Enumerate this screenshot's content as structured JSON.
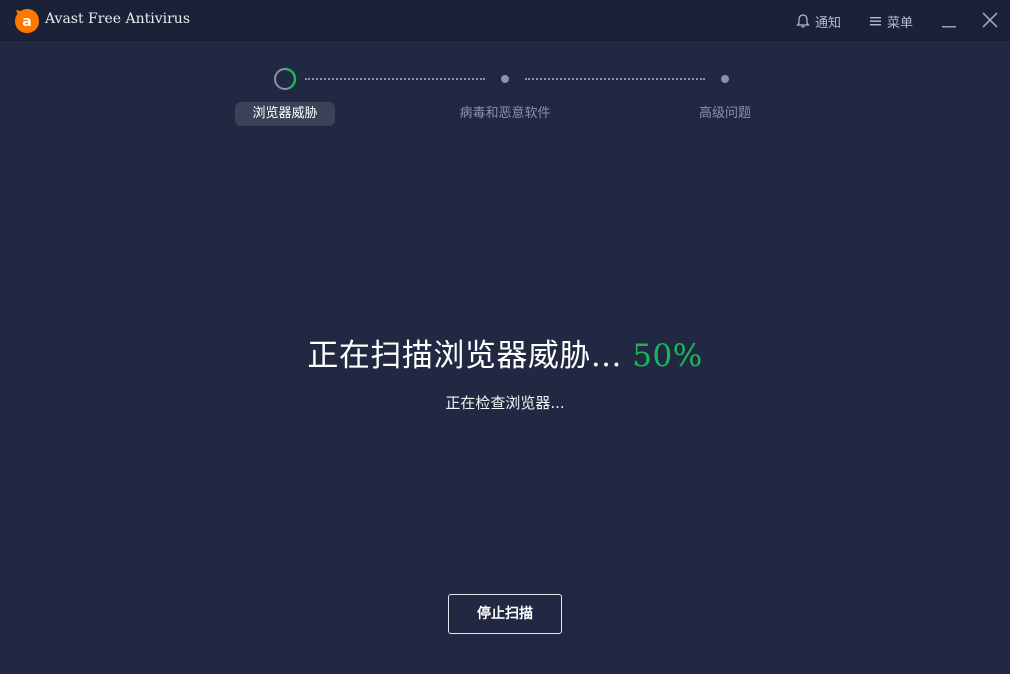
{
  "app": {
    "title": "Avast Free Antivirus",
    "brand_color": "#ff7800"
  },
  "titlebar": {
    "notify_label": "通知",
    "menu_label": "菜单"
  },
  "steps": [
    {
      "label": "浏览器威胁",
      "state": "active"
    },
    {
      "label": "病毒和恶意软件",
      "state": "pending"
    },
    {
      "label": "高级问题",
      "state": "pending"
    }
  ],
  "scan": {
    "headline": "正在扫描浏览器威胁...",
    "percent_text": "50%",
    "progress": 0.5,
    "status": "正在检查浏览器...",
    "accent_color": "#1bb55c"
  },
  "actions": {
    "stop_label": "停止扫描"
  }
}
